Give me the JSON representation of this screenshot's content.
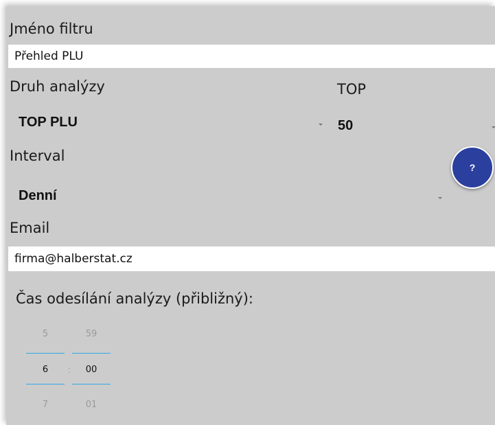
{
  "filter": {
    "name_label": "Jméno filtru",
    "name_value": "Přehled PLU"
  },
  "analysis": {
    "type_label": "Druh analýzy",
    "type_value": "TOP PLU",
    "top_label": "TOP",
    "top_value": "50"
  },
  "interval": {
    "label": "Interval",
    "value": "Denní"
  },
  "email": {
    "label": "Email",
    "value": "firma@halberstat.cz"
  },
  "time": {
    "label": "Čas odesílání analýzy (přibližný):",
    "hour_prev": "5",
    "hour": "6",
    "hour_next": "7",
    "separator": ":",
    "minute_prev": "59",
    "minute": "00",
    "minute_next": "01"
  },
  "help": {
    "label": "?"
  },
  "colors": {
    "panel_bg": "#cccccc",
    "help_button": "#2b3f9e",
    "picker_accent": "#31a9e3"
  }
}
